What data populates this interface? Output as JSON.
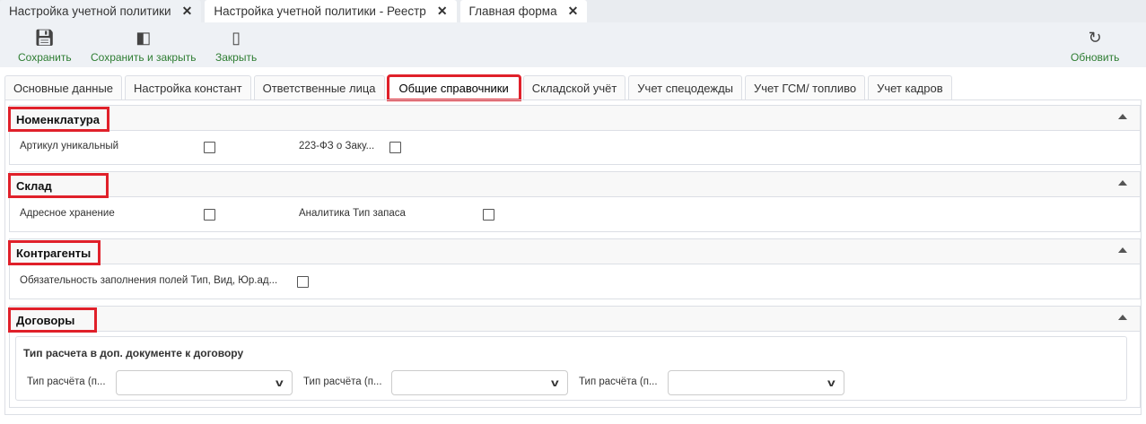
{
  "doc_tabs": [
    {
      "label": "Настройка учетной политики"
    },
    {
      "label": "Настройка учетной политики - Реестр"
    },
    {
      "label": "Главная форма"
    }
  ],
  "toolbar": {
    "save": "Сохранить",
    "save_close": "Сохранить и закрыть",
    "close": "Закрыть",
    "refresh": "Обновить"
  },
  "form_tabs": [
    "Основные данные",
    "Настройка констант",
    "Ответственные лица",
    "Общие справочники",
    "Складской учёт",
    "Учет спецодежды",
    "Учет ГСМ/ топливо",
    "Учет кадров"
  ],
  "sections": {
    "nomenclature": {
      "title": "Номенклатура",
      "f1": "Артикул уникальный",
      "f2": "223-ФЗ о Заку..."
    },
    "warehouse": {
      "title": "Склад",
      "f1": "Адресное хранение",
      "f2": "Аналитика Тип запаса"
    },
    "contractors": {
      "title": "Контрагенты",
      "f1": "Обязательность заполнения полей Тип, Вид, Юр.ад..."
    },
    "contracts": {
      "title": "Договоры",
      "group": "Тип расчета в доп. документе к договору",
      "s1": "Тип расчёта (п...",
      "s2": "Тип расчёта (п...",
      "s3": "Тип расчёта (п..."
    }
  },
  "colors": {
    "accent": "#2e7d32",
    "highlight": "#e0202a"
  }
}
